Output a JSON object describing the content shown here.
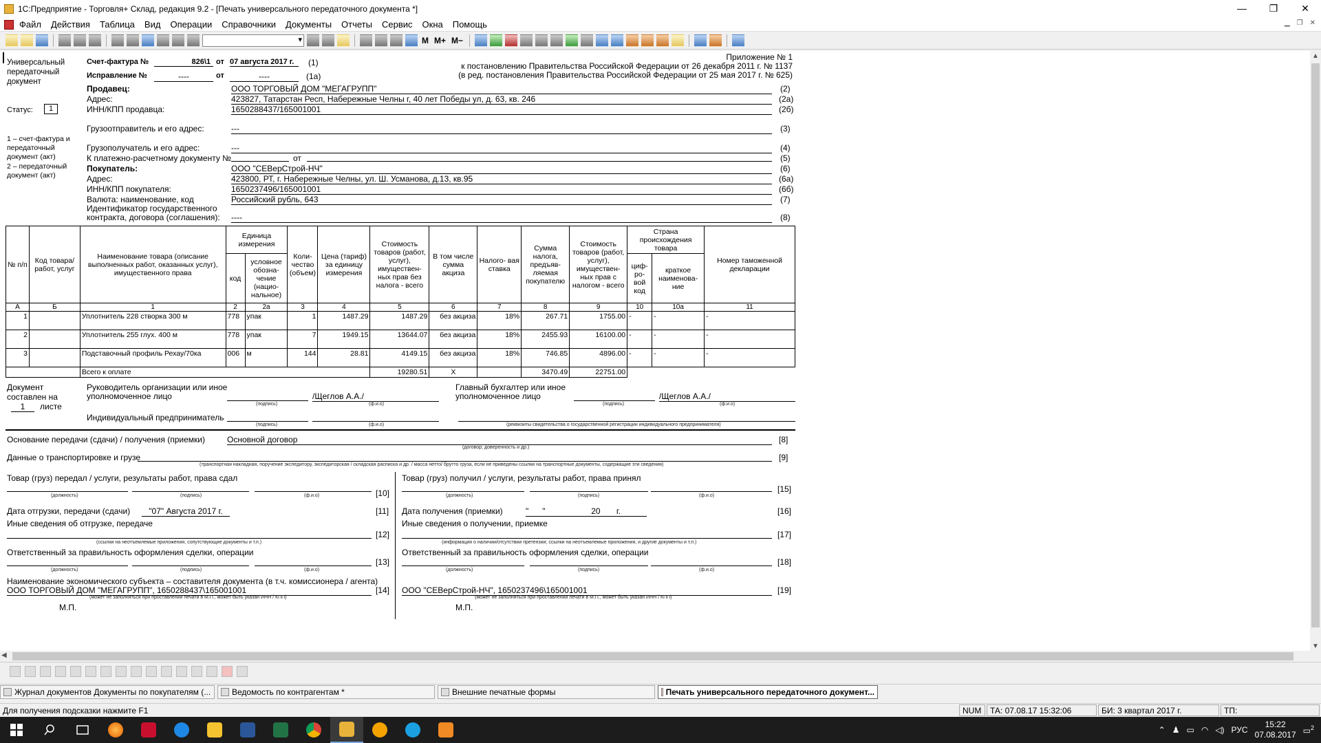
{
  "window": {
    "title": "1С:Предприятие - Торговля+ Склад, редакция 9.2 - [Печать универсального передаточного документа  *]",
    "btn_min": "—",
    "btn_max": "❐",
    "btn_close": "✕"
  },
  "menu": [
    "Файл",
    "Действия",
    "Таблица",
    "Вид",
    "Операции",
    "Справочники",
    "Документы",
    "Отчеты",
    "Сервис",
    "Окна",
    "Помощь"
  ],
  "toolbar": {
    "m": "M",
    "m_plus": "M+",
    "m_minus": "M−"
  },
  "doc": {
    "side_title": "Универсальный передаточный документ",
    "status_label": "Статус:",
    "status_value": "1",
    "status_note1": "1 – счет-фактура и передаточный документ (акт)",
    "status_note2": "2 – передаточный документ (акт)",
    "invoice_label": "Счет-фактура №",
    "invoice_no": "826\\1",
    "from": "от",
    "invoice_date": "07 августа 2017 г.",
    "n1": "(1)",
    "correction_label": "Исправление №",
    "correction_no": "----",
    "correction_date": "----",
    "n1a": "(1а)",
    "appendix1": "Приложение № 1",
    "appendix2": "к постановлению Правительства Российской Федерации от 26 декабря 2011 г. № 1137",
    "appendix3": "(в ред. постановления Правительства Российской Федерации от 25 мая 2017 г. № 625)",
    "seller_label": "Продавец:",
    "seller": "ООО ТОРГОВЫЙ ДОМ \"МЕГАГРУПП\"",
    "n2": "(2)",
    "address_label": "Адрес:",
    "seller_address": "423827, Татарстан Респ, Набережные Челны г, 40 лет Победы ул, д. 63, кв. 246",
    "n2a": "(2а)",
    "seller_inn_label": "ИНН/КПП продавца:",
    "seller_inn": "1650288437/165001001",
    "n2b": "(2б)",
    "shipper_label": "Грузоотправитель и его адрес:",
    "shipper": "---",
    "n3": "(3)",
    "consignee_label": "Грузополучатель и его адрес:",
    "consignee": "---",
    "n4": "(4)",
    "payment_doc_label": "К платежно-расчетному документу №",
    "n5": "(5)",
    "buyer_label": "Покупатель:",
    "buyer": "ООО \"СЕВерСтрой-НЧ\"",
    "n6": "(6)",
    "buyer_address": "423800, РТ, г. Набережные Челны, ул. Ш. Усманова, д.13, кв.95",
    "n6a": "(6а)",
    "buyer_inn_label": "ИНН/КПП покупателя:",
    "buyer_inn": "1650237496/165001001",
    "n6b": "(6б)",
    "currency_label": "Валюта: наименование, код",
    "currency": "Российский рубль, 643",
    "n7": "(7)",
    "gov_label1": "Идентификатор государственного",
    "gov_label2": "контракта, договора (соглашения):",
    "gov": "----",
    "n8": "(8)"
  },
  "table": {
    "headers": {
      "h_no": "№ п/п",
      "h_code": "Код товара/ работ, услуг",
      "h_name": "Наименование товара (описание выполненных работ, оказанных услуг), имущественного права",
      "h_unit": "Единица измерения",
      "h_unit_code": "код",
      "h_unit_name": "условное обозна- чение (нацио- нальное)",
      "h_qty": "Коли- чество (объем)",
      "h_price": "Цена (тариф) за единицу измерения",
      "h_cost": "Стоимость товаров (работ, услуг), имуществен- ных прав без налога - всего",
      "h_excise": "В том числе сумма акциза",
      "h_rate": "Налого- вая ставка",
      "h_tax": "Сумма налога, предъяв- ляемая покупателю",
      "h_total": "Стоимость товаров (работ, услуг), имуществен- ных прав с налогом - всего",
      "h_country": "Страна происхождения товара",
      "h_country_code": "циф- ро- вой код",
      "h_country_name": "краткое наименова- ние",
      "h_customs": "Номер таможенной декларации"
    },
    "index": [
      "А",
      "Б",
      "1",
      "2",
      "2а",
      "3",
      "4",
      "5",
      "6",
      "7",
      "8",
      "9",
      "10",
      "10а",
      "11"
    ],
    "rows": [
      {
        "no": "1",
        "code": "",
        "name": "Уплотнитель 228 створка 300 м",
        "unit_code": "778",
        "unit": "упак",
        "qty": "1",
        "price": "1487.29",
        "cost": "1487.29",
        "excise": "без акциза",
        "rate": "18%",
        "tax": "267.71",
        "total": "1755.00",
        "cc": "-",
        "cn": "-",
        "cd": "-"
      },
      {
        "no": "2",
        "code": "",
        "name": "Уплотнитель 255 глух. 400 м",
        "unit_code": "778",
        "unit": "упак",
        "qty": "7",
        "price": "1949.15",
        "cost": "13644.07",
        "excise": "без акциза",
        "rate": "18%",
        "tax": "2455.93",
        "total": "16100.00",
        "cc": "-",
        "cn": "-",
        "cd": "-"
      },
      {
        "no": "3",
        "code": "",
        "name": "Подставочный профиль Рехау/70ка",
        "unit_code": "006",
        "unit": "м",
        "qty": "144",
        "price": "28.81",
        "cost": "4149.15",
        "excise": "без акциза",
        "rate": "18%",
        "tax": "746.85",
        "total": "4896.00",
        "cc": "-",
        "cn": "-",
        "cd": "-"
      }
    ],
    "total_label": "Всего к оплате",
    "total_cost": "19280.51",
    "total_excise": "X",
    "total_tax": "3470.49",
    "total_total": "22751.00"
  },
  "sign": {
    "doc_made1": "Документ составлен на",
    "doc_sheets": "1",
    "doc_made2": "листе",
    "head1": "Руководитель организации или иное",
    "head2": "уполномоченное лицо",
    "head_name": "/Щеглов А.А./",
    "acc1": "Главный бухгалтер или иное",
    "acc2": "уполномоченное лицо",
    "acc_name": "/Щеглов А.А./",
    "ip": "Индивидуальный предприниматель",
    "sig": "(подпись)",
    "fio": "(ф.и.о)",
    "ip_req": "(реквизиты свидетельства о государственной регистрации индивидуального предпринимателя)"
  },
  "lower": {
    "basis_label": "Основание передачи (сдачи) / получения (приемки)",
    "basis": "Основной договор",
    "basis_hint": "(договор; доверенность и др.)",
    "n8b": "[8]",
    "transport_label": "Данные о транспортировке и грузе",
    "transport_hint": "(транспортная накладная, поручение экспедитору, экспедиторская / складская расписка и др. / масса нетто/ брутто груза, если не приведены ссылки на транспортные документы, содержащие эти сведения)",
    "n9": "[9]",
    "handed_label": "Товар (груз) передал / услуги, результаты работ, права сдал",
    "received_label": "Товар (груз) получил / услуги, результаты работ, права  принял",
    "pos": "(должность)",
    "sig": "(подпись)",
    "fio": "(ф.и.о)",
    "n10": "[10]",
    "n15": "[15]",
    "ship_date_label": "Дата отгрузки, передачи (сдачи)",
    "ship_date": "\"07\"   Августа 2017 г.",
    "n11": "[11]",
    "recv_date_label": "Дата получения (приемки)",
    "recv_date": "\"      \"                    20       г.",
    "n16": "[16]",
    "other_ship_label": "Иные сведения об отгрузке, передаче",
    "other_ship_hint": "(ссылки на неотъемлемые приложения, сопутствующие документы и т.п.)",
    "n12": "[12]",
    "other_recv_label": "Иные сведения о получении, приемке",
    "other_recv_hint": "(информация о наличии/отсутствии претензии; ссылки на неотъемлемые приложения, и другие документы и т.п.)",
    "n17": "[17]",
    "resp_label": "Ответственный за правильность оформления сделки, операции",
    "n13": "[13]",
    "n18": "[18]",
    "entity_label": "Наименование экономического субъекта – составителя документа (в т.ч. комиссионера / агента)",
    "entity_left": "ООО ТОРГОВЫЙ ДОМ \"МЕГАГРУПП\", 1650288437\\165001001",
    "entity_right": "ООО \"СЕВерСтрой-НЧ\", 1650237496\\165001001",
    "entity_hint": "(может не заполняться при проставлении печати в М.П., может быть указан ИНН / КПП)",
    "n14": "[14]",
    "n19": "[19]",
    "mp": "М.П."
  },
  "windows": [
    "Журнал документов  Документы по покупателям (...",
    "Ведомость по контрагентам  *",
    "Внешние печатные формы",
    "Печать универсального передаточного документ..."
  ],
  "status": {
    "hint": "Для получения подсказки нажмите F1",
    "num": "NUM",
    "ta": "ТА: 07.08.17  15:32:06",
    "bi": "БИ: 3 квартал 2017 г.",
    "tp": "ТП:"
  },
  "tray": {
    "lang": "РУС",
    "time": "15:22",
    "date": "07.08.2017",
    "notif": "2"
  }
}
